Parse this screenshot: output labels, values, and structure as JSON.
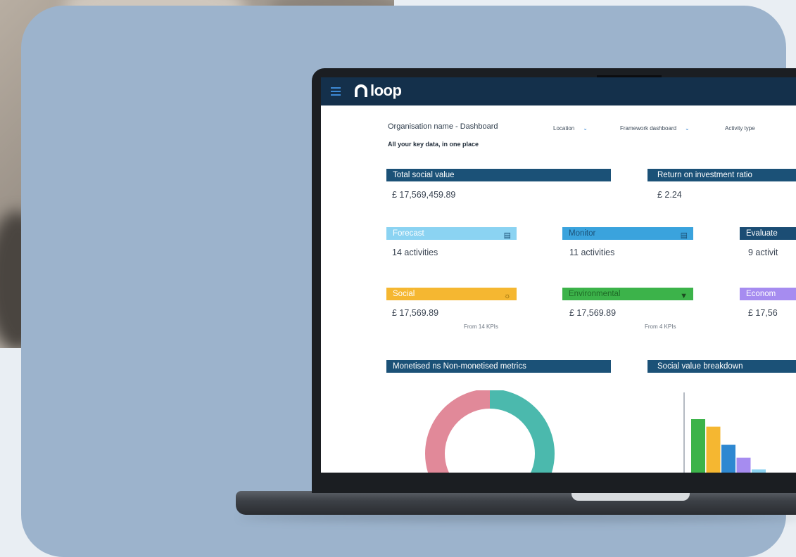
{
  "app": {
    "logo_text": "loop",
    "menu_icon": "hamburger-menu-icon"
  },
  "header": {
    "title": "Organisation name - Dashboard",
    "subtitle": "All your key data, in one place",
    "filters": [
      {
        "label": "Location"
      },
      {
        "label": "Framework dashboard"
      },
      {
        "label": "Activity type"
      }
    ]
  },
  "metrics": {
    "total_social_value": {
      "label": "Total social value",
      "value": "£  17,569,459.89"
    },
    "roi": {
      "label": "Return on investment ratio",
      "value": "£  2.24"
    }
  },
  "stages": [
    {
      "label": "Forecast",
      "value": "14 activities",
      "color": "#8bd3f2"
    },
    {
      "label": "Monitor",
      "value": "11 activities",
      "color": "#3aa3dd"
    },
    {
      "label": "Evaluate",
      "value": "9 activit",
      "color": "#1b4d74"
    }
  ],
  "categories": [
    {
      "label": "Social",
      "value": "£  17,569.89",
      "note": "From 14 KPIs",
      "color": "#f5b731"
    },
    {
      "label": "Environmental",
      "value": "£  17,569.89",
      "note": "From 4 KPIs",
      "color": "#3cb34a"
    },
    {
      "label": "Econom",
      "value": "£  17,56",
      "note": "",
      "color": "#a68cf0"
    }
  ],
  "sections": {
    "monetised": "Monetised ns Non-monetised metrics",
    "breakdown": "Social value breakdown"
  },
  "colors": {
    "navy": "#14304b",
    "header_bar": "#1b5177",
    "card_bg": "#9cb3cc"
  },
  "chart_data": [
    {
      "type": "pie",
      "title": "Monetised ns Non-monetised metrics",
      "slices": [
        {
          "value": 0.5,
          "color": "#4bb9ad"
        },
        {
          "value": 0.5,
          "color": "#e18999"
        }
      ]
    },
    {
      "type": "bar",
      "title": "Social value breakdown",
      "values": [
        100,
        86,
        52,
        28,
        6
      ],
      "colors": [
        "#3cb34a",
        "#f5b731",
        "#2e88d1",
        "#a68cf0",
        "#8bd3f2"
      ]
    }
  ]
}
